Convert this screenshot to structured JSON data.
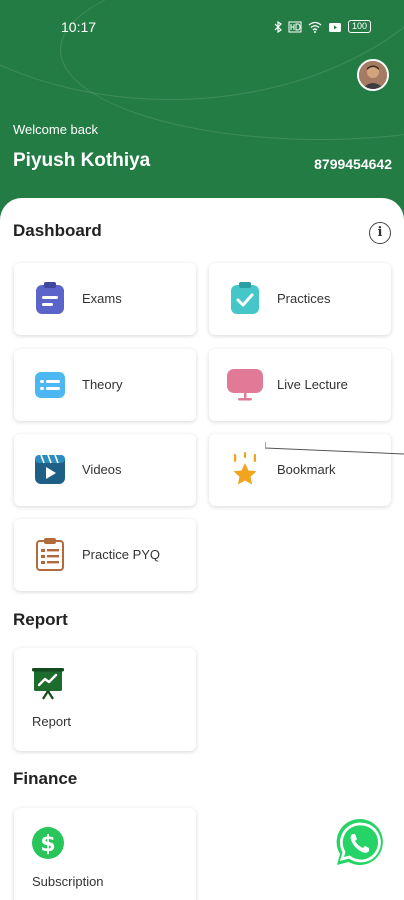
{
  "status": {
    "time": "10:17",
    "battery": "100",
    "icons": [
      "bluetooth-icon",
      "hd-icon",
      "wifi-icon",
      "video-icon",
      "battery-icon"
    ]
  },
  "header": {
    "welcome": "Welcome back",
    "name": "Piyush Kothiya",
    "phone": "8799454642"
  },
  "sections": {
    "dashboard": "Dashboard",
    "report": "Report",
    "finance": "Finance"
  },
  "dashboard": {
    "exams": "Exams",
    "practices": "Practices",
    "theory": "Theory",
    "live_lecture": "Live Lecture",
    "videos": "Videos",
    "bookmark": "Bookmark",
    "practice_pyq": "Practice PYQ"
  },
  "report": {
    "report": "Report"
  },
  "finance": {
    "subscription": "Subscription"
  },
  "colors": {
    "header_green": "#247c45",
    "whatsapp": "#25d366"
  }
}
